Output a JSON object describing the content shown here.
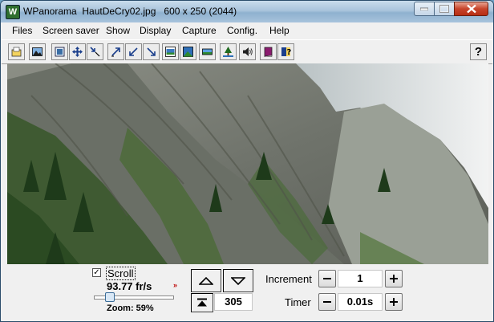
{
  "window": {
    "app_name": "WPanorama",
    "title": "WPanorama  HautDeCry02.jpg   600 x 250 (2044)",
    "app_icon_letter": "W"
  },
  "menu": {
    "items": [
      "Files",
      "Screen saver",
      "Show",
      "Display",
      "Capture",
      "Config.",
      "Help"
    ]
  },
  "toolbar": {
    "buttons": [
      "open-file-icon",
      "picture-icon",
      "fit-window-icon",
      "move-icon",
      "shrink-diagonal-icon",
      "expand-up-right-icon",
      "shrink-down-left-icon",
      "expand-down-right-icon",
      "landscape-frame-icon",
      "landscape-wide-icon",
      "landscape-band-icon",
      "tree-icon",
      "speaker-icon",
      "book-icon",
      "help-book-icon"
    ],
    "help_label": "?"
  },
  "controls": {
    "scroll_label": "Scroll",
    "scroll_checked": true,
    "fps": "93.77 fr/s",
    "zoom": "Zoom: 59%",
    "zoom_slider_fraction": 0.18,
    "position_value": "305",
    "increment_label": "Increment",
    "increment_value": "1",
    "timer_label": "Timer",
    "timer_value": "0.01s"
  }
}
